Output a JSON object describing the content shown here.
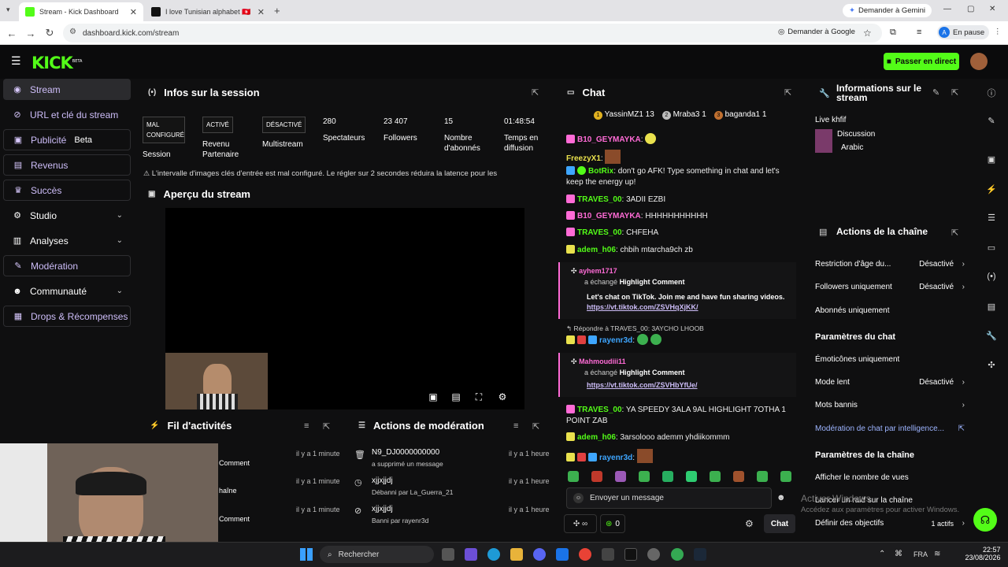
{
  "browser": {
    "tabs": [
      {
        "title": "Stream - Kick Dashboard",
        "active": true
      },
      {
        "title": "I love Tunisian alphabet 🇹🇳",
        "active": false
      }
    ],
    "new_tab_icon": "plus-icon",
    "gemini_button": "Demander à Gemini",
    "url": "dashboard.kick.com/stream",
    "google_button": "Demander à Google",
    "profile_initial": "A",
    "profile_status": "En pause"
  },
  "header": {
    "logo": "KICK",
    "logo_badge": "BETA",
    "go_live": "Passer en direct"
  },
  "sidebar": {
    "items": [
      {
        "label": "Stream",
        "icon": "signal-icon",
        "active": true
      },
      {
        "label": "URL et clé du stream",
        "icon": "link-icon"
      },
      {
        "label": "Publicité",
        "icon": "megaphone-icon",
        "extra": "Beta"
      },
      {
        "label": "Revenus",
        "icon": "dollar-icon"
      },
      {
        "label": "Succès",
        "icon": "trophy-icon"
      },
      {
        "label": "Studio",
        "icon": "sliders-icon"
      },
      {
        "label": "Analyses",
        "icon": "chart-icon"
      },
      {
        "label": "Modération",
        "icon": "wrench-icon"
      },
      {
        "label": "Communauté",
        "icon": "users-icon"
      },
      {
        "label": "Drops & Récompenses",
        "icon": "gift-icon"
      }
    ]
  },
  "session": {
    "title": "Infos sur la session",
    "stats": [
      {
        "badge": "MAL CONFIGURÉ",
        "label": "Session"
      },
      {
        "badge": "ACTIVÉ",
        "label": "Revenu Partenaire"
      },
      {
        "badge": "DÉSACTIVÉ",
        "label": "Multistream"
      },
      {
        "value": "280",
        "label": "Spectateurs"
      },
      {
        "value": "23 407",
        "label": "Followers"
      },
      {
        "value": "15",
        "label": "Nombre d'abonnés"
      },
      {
        "value": "01:48:54",
        "label": "Temps en diffusion"
      }
    ],
    "warning": "L'intervalle d'images clés d'entrée est mal configuré. Le régler sur 2 secondes réduira la latence pour les"
  },
  "preview": {
    "title": "Aperçu du stream"
  },
  "activity": {
    "title": "Fil d'activités",
    "rows": [
      {
        "text": "Comment",
        "time": "il y a 1 minute"
      },
      {
        "text": "haîne",
        "time": "il y a 1 minute"
      },
      {
        "text": "Comment",
        "time": "il y a 1 minute"
      }
    ]
  },
  "mod_actions": {
    "title": "Actions de modération",
    "rows": [
      {
        "user": "N9_DJ0000000000",
        "action": "a supprimé un message",
        "time": "il y a 1 heure"
      },
      {
        "user": "xjjxjjdj",
        "action": "Débanni par La_Guerra_21",
        "time": "il y a 1 heure"
      },
      {
        "user": "xjjxjjdj",
        "action": "Banni par rayenr3d",
        "time": "il y a 1 heure"
      }
    ]
  },
  "chat": {
    "title": "Chat",
    "top_gifters": [
      {
        "rank": "1",
        "name": "YassinMZ1",
        "count": "13"
      },
      {
        "rank": "2",
        "name": "Mraba3",
        "count": "1"
      },
      {
        "rank": "3",
        "name": "bagandа1",
        "count": "1"
      }
    ],
    "messages": [
      {
        "user": "B10_GEYMAYKA",
        "text": "",
        "color": "#ff6bd6"
      },
      {
        "user": "FreezyX1",
        "text": "",
        "color": "#e9e14d"
      },
      {
        "user": "BotRix",
        "text": "don't go AFK! Type something in chat and let's keep the energy up!",
        "color": "#53fc18"
      },
      {
        "user": "TRAVES_00",
        "text": "3ADII EZBI",
        "color": "#53fc18"
      },
      {
        "user": "B10_GEYMAYKA",
        "text": "HHHHHHHHHHH",
        "color": "#ff6bd6"
      },
      {
        "user": "TRAVES_00",
        "text": "CHFEHA",
        "color": "#53fc18"
      },
      {
        "user": "adem_h06",
        "text": "chbih mtarcha9ch zb",
        "color": "#53fc18"
      }
    ],
    "highlight1": {
      "user": "ayhem1717",
      "action": "a échangé",
      "reward": "Highlight Comment",
      "text": "Let's chat on TikTok. Join me and have fun sharing videos.",
      "link": "https://vt.tiktok.com/ZSVHqXjKK/"
    },
    "reply": {
      "label": "Répondre à TRAVES_00: 3AYCHO LHOOB",
      "user": "rayenr3d"
    },
    "highlight2": {
      "user": "Mahmoudiii11",
      "action": "a échangé",
      "reward": "Highlight Comment",
      "link": "https://vt.tiktok.com/ZSVHbYfUe/"
    },
    "messages2": [
      {
        "user": "TRAVES_00",
        "text": "YA SPEEDY 3ALA 9AL HIGHLIGHT 7OTHA 1 POINT ZAB",
        "color": "#53fc18"
      },
      {
        "user": "adem_h06",
        "text": "3arsolooo ademm yhdiikommm",
        "color": "#53fc18"
      },
      {
        "user": "rayenr3d",
        "text": "",
        "color": "#3ea6ff"
      }
    ],
    "input_placeholder": "Envoyer un message",
    "points": "0",
    "send": "Chat"
  },
  "stream_info": {
    "title": "Informations sur le stream",
    "stream_title": "Live khfif",
    "category": "Discussion",
    "language": "Arabic"
  },
  "channel_actions": {
    "title": "Actions de la chaîne",
    "rows": [
      {
        "label": "Restriction d'âge du...",
        "value": "Désactivé",
        "chevron": true
      },
      {
        "label": "Followers uniquement",
        "value": "Désactivé",
        "chevron": true
      },
      {
        "label": "Abonnés uniquement",
        "value": "",
        "chevron": false
      }
    ],
    "chat_settings_title": "Paramètres du chat",
    "chat_rows": [
      {
        "label": "Émoticônes uniquement",
        "value": "",
        "chevron": false
      },
      {
        "label": "Mode lent",
        "value": "Désactivé",
        "chevron": true
      },
      {
        "label": "Mots bannis",
        "value": "",
        "chevron": true
      },
      {
        "label": "Modération de chat par intelligence...",
        "value": "",
        "chevron": false,
        "link": true
      }
    ],
    "channel_settings_title": "Paramètres de la chaîne",
    "channel_rows": [
      {
        "label": "Afficher le nombre de vues",
        "value": ""
      },
      {
        "label": "Lancer un raid sur la chaîne",
        "value": ""
      },
      {
        "label": "Définir des objectifs",
        "value": "1 actifs"
      }
    ]
  },
  "watermark": {
    "line1": "Activer Windows",
    "line2": "Accédez aux paramètres pour activer Windows."
  },
  "taskbar": {
    "search": "Rechercher",
    "lang": "FRA",
    "time": "22:57",
    "date": "23/08/2026"
  },
  "colors": {
    "kick_green": "#53fc18",
    "accent_purple": "#cdbdf8",
    "gem_pink": "#ff6bd6"
  }
}
